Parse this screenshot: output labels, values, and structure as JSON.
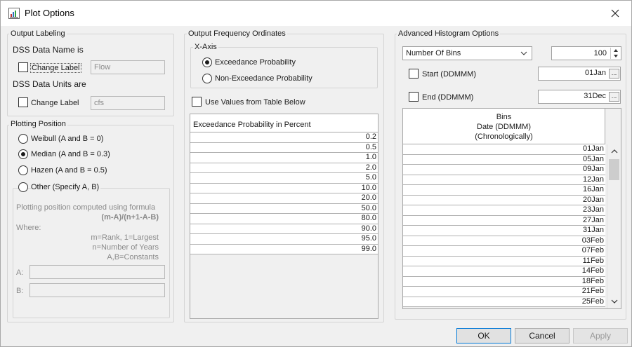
{
  "window": {
    "title": "Plot Options"
  },
  "output_labeling": {
    "title": "Output Labeling",
    "name_heading": "DSS Data Name is",
    "name_checkbox": "Change Label",
    "name_value": "Flow",
    "units_heading": "DSS Data Units are",
    "units_checkbox": "Change Label",
    "units_value": "cfs"
  },
  "plotting_position": {
    "title": "Plotting Position",
    "options": [
      "Weibull (A and B = 0)",
      "Median (A and B = 0.3)",
      "Hazen (A and B = 0.5)",
      "Other (Specify A, B)"
    ],
    "selected": "Median (A and B = 0.3)",
    "formula_intro": "Plotting position computed using formula",
    "formula": "(m-A)/(n+1-A-B)",
    "where": "Where:",
    "def1": "m=Rank, 1=Largest",
    "def2": "n=Number of Years",
    "def3": "A,B=Constants",
    "a_label": "A:",
    "b_label": "B:"
  },
  "ordinates": {
    "title": "Output Frequency Ordinates",
    "xaxis_title": "X-Axis",
    "xaxis_options": [
      "Exceedance Probability",
      "Non-Exceedance Probability"
    ],
    "use_values": "Use Values from Table Below",
    "table_header": "Exceedance Probability in Percent",
    "values": [
      "0.2",
      "0.5",
      "1.0",
      "2.0",
      "5.0",
      "10.0",
      "20.0",
      "50.0",
      "80.0",
      "90.0",
      "95.0",
      "99.0"
    ]
  },
  "histogram": {
    "title": "Advanced Histogram Options",
    "mode": "Number Of Bins",
    "bins_count": "100",
    "start_label": "Start (DDMMM)",
    "start_value": "01Jan",
    "end_label": "End (DDMMM)",
    "end_value": "31Dec",
    "browse": "...",
    "table_header": [
      "Bins",
      "Date (DDMMM)",
      "(Chronologically)"
    ],
    "bins": [
      "01Jan",
      "05Jan",
      "09Jan",
      "12Jan",
      "16Jan",
      "20Jan",
      "23Jan",
      "27Jan",
      "31Jan",
      "03Feb",
      "07Feb",
      "11Feb",
      "14Feb",
      "18Feb",
      "21Feb",
      "25Feb"
    ]
  },
  "buttons": {
    "ok": "OK",
    "cancel": "Cancel",
    "apply": "Apply"
  }
}
